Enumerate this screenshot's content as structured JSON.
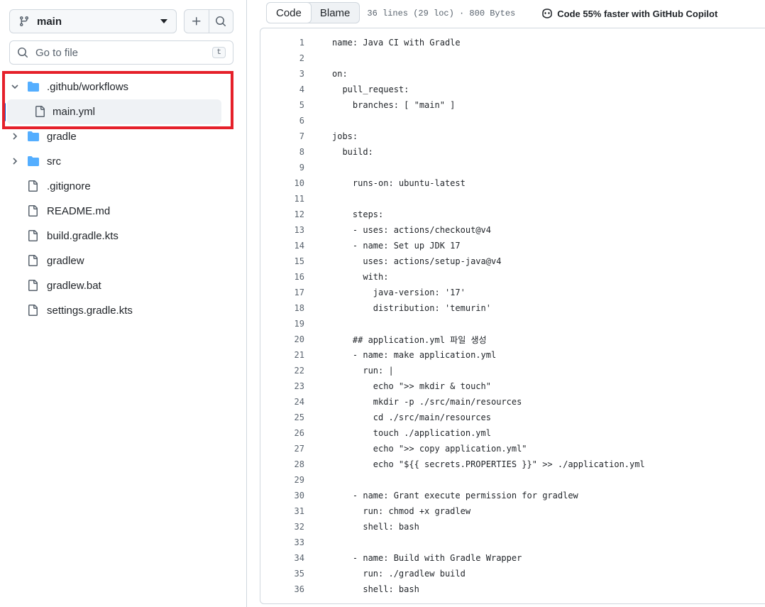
{
  "sidebar": {
    "branch": "main",
    "search_placeholder": "Go to file",
    "search_shortcut": "t",
    "tree": [
      {
        "name": ".github/workflows",
        "type": "folder",
        "expanded": true
      },
      {
        "name": "main.yml",
        "type": "file",
        "selected": true,
        "nested": true
      },
      {
        "name": "gradle",
        "type": "folder",
        "expanded": false
      },
      {
        "name": "src",
        "type": "folder",
        "expanded": false
      },
      {
        "name": ".gitignore",
        "type": "file"
      },
      {
        "name": "README.md",
        "type": "file"
      },
      {
        "name": "build.gradle.kts",
        "type": "file"
      },
      {
        "name": "gradlew",
        "type": "file"
      },
      {
        "name": "gradlew.bat",
        "type": "file"
      },
      {
        "name": "settings.gradle.kts",
        "type": "file"
      }
    ]
  },
  "toolbar": {
    "code_tab": "Code",
    "blame_tab": "Blame",
    "file_info": "36 lines (29 loc) · 800 Bytes",
    "copilot": "Code 55% faster with GitHub Copilot"
  },
  "code": {
    "lines": [
      "name: Java CI with Gradle",
      "",
      "on:",
      "  pull_request:",
      "    branches: [ \"main\" ]",
      "",
      "jobs:",
      "  build:",
      "",
      "    runs-on: ubuntu-latest",
      "",
      "    steps:",
      "    - uses: actions/checkout@v4",
      "    - name: Set up JDK 17",
      "      uses: actions/setup-java@v4",
      "      with:",
      "        java-version: '17'",
      "        distribution: 'temurin'",
      "",
      "    ## application.yml 파일 생성",
      "    - name: make application.yml",
      "      run: |",
      "        echo \">> mkdir & touch\"",
      "        mkdir -p ./src/main/resources",
      "        cd ./src/main/resources",
      "        touch ./application.yml",
      "        echo \">> copy application.yml\"",
      "        echo \"${{ secrets.PROPERTIES }}\" >> ./application.yml",
      "",
      "    - name: Grant execute permission for gradlew",
      "      run: chmod +x gradlew",
      "      shell: bash",
      "",
      "    - name: Build with Gradle Wrapper",
      "      run: ./gradlew build",
      "      shell: bash"
    ]
  },
  "colors": {
    "highlight_border": "#e5202a",
    "folder": "#54aeff",
    "selection_bar": "#0969da"
  }
}
